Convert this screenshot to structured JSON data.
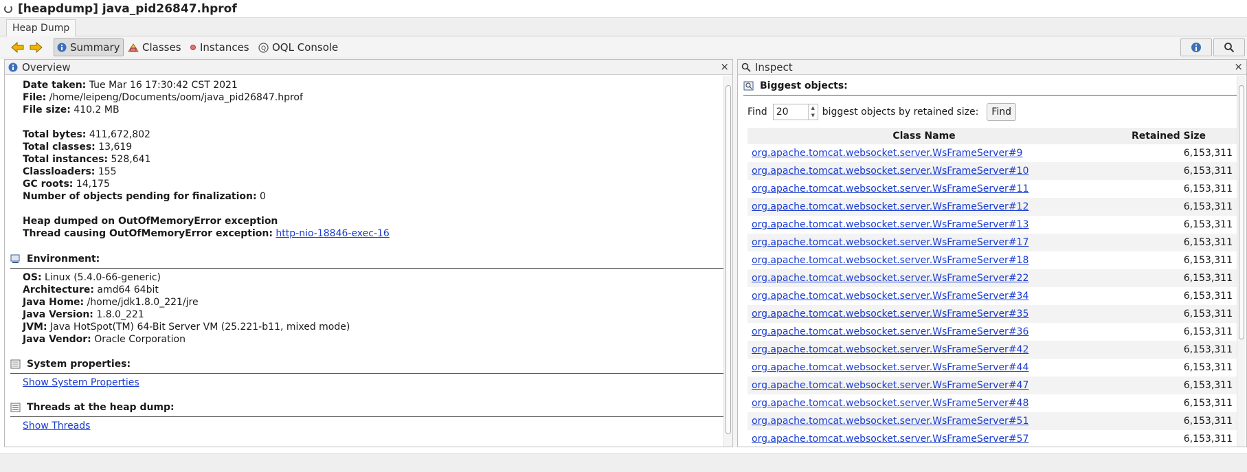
{
  "window": {
    "title": "[heapdump] java_pid26847.hprof"
  },
  "tabs": {
    "heap_dump": "Heap Dump"
  },
  "toolbar": {
    "summary": "Summary",
    "classes": "Classes",
    "instances": "Instances",
    "oql": "OQL Console"
  },
  "overview": {
    "title": "Overview",
    "close": "×",
    "basic": [
      {
        "label": "Date taken:",
        "value": "Tue Mar 16 17:30:42 CST 2021"
      },
      {
        "label": "File:",
        "value": "/home/leipeng/Documents/oom/java_pid26847.hprof"
      },
      {
        "label": "File size:",
        "value": "410.2 MB"
      }
    ],
    "totals": [
      {
        "label": "Total bytes:",
        "value": "411,672,802"
      },
      {
        "label": "Total classes:",
        "value": "13,619"
      },
      {
        "label": "Total instances:",
        "value": "528,641"
      },
      {
        "label": "Classloaders:",
        "value": "155"
      },
      {
        "label": "GC roots:",
        "value": "14,175"
      },
      {
        "label": "Number of objects pending for finalization:",
        "value": "0"
      }
    ],
    "oom_line": "Heap dumped on OutOfMemoryError exception",
    "oom_thread_label": "Thread causing OutOfMemoryError exception:",
    "oom_thread_link": "http-nio-18846-exec-16",
    "environment": {
      "heading": "Environment:",
      "items": [
        {
          "label": "OS:",
          "value": "Linux (5.4.0-66-generic)"
        },
        {
          "label": "Architecture:",
          "value": "amd64 64bit"
        },
        {
          "label": "Java Home:",
          "value": "/home/jdk1.8.0_221/jre"
        },
        {
          "label": "Java Version:",
          "value": "1.8.0_221"
        },
        {
          "label": "JVM:",
          "value": "Java HotSpot(TM) 64-Bit Server VM (25.221-b11, mixed mode)"
        },
        {
          "label": "Java Vendor:",
          "value": "Oracle Corporation"
        }
      ]
    },
    "system_properties": {
      "heading": "System properties:",
      "link": "Show System Properties"
    },
    "threads": {
      "heading": "Threads at the heap dump:",
      "link": "Show Threads"
    }
  },
  "inspect": {
    "title": "Inspect",
    "close": "×",
    "heading": "Biggest objects:",
    "find_label": "Find",
    "find_value": "20",
    "find_suffix": "biggest objects by retained size:",
    "find_button": "Find",
    "columns": {
      "name": "Class Name",
      "size": "Retained Size"
    },
    "rows": [
      {
        "name": "org.apache.tomcat.websocket.server.WsFrameServer#9",
        "size": "6,153,311"
      },
      {
        "name": "org.apache.tomcat.websocket.server.WsFrameServer#10",
        "size": "6,153,311"
      },
      {
        "name": "org.apache.tomcat.websocket.server.WsFrameServer#11",
        "size": "6,153,311"
      },
      {
        "name": "org.apache.tomcat.websocket.server.WsFrameServer#12",
        "size": "6,153,311"
      },
      {
        "name": "org.apache.tomcat.websocket.server.WsFrameServer#13",
        "size": "6,153,311"
      },
      {
        "name": "org.apache.tomcat.websocket.server.WsFrameServer#17",
        "size": "6,153,311"
      },
      {
        "name": "org.apache.tomcat.websocket.server.WsFrameServer#18",
        "size": "6,153,311"
      },
      {
        "name": "org.apache.tomcat.websocket.server.WsFrameServer#22",
        "size": "6,153,311"
      },
      {
        "name": "org.apache.tomcat.websocket.server.WsFrameServer#34",
        "size": "6,153,311"
      },
      {
        "name": "org.apache.tomcat.websocket.server.WsFrameServer#35",
        "size": "6,153,311"
      },
      {
        "name": "org.apache.tomcat.websocket.server.WsFrameServer#36",
        "size": "6,153,311"
      },
      {
        "name": "org.apache.tomcat.websocket.server.WsFrameServer#42",
        "size": "6,153,311"
      },
      {
        "name": "org.apache.tomcat.websocket.server.WsFrameServer#44",
        "size": "6,153,311"
      },
      {
        "name": "org.apache.tomcat.websocket.server.WsFrameServer#47",
        "size": "6,153,311"
      },
      {
        "name": "org.apache.tomcat.websocket.server.WsFrameServer#48",
        "size": "6,153,311"
      },
      {
        "name": "org.apache.tomcat.websocket.server.WsFrameServer#51",
        "size": "6,153,311"
      },
      {
        "name": "org.apache.tomcat.websocket.server.WsFrameServer#57",
        "size": "6,153,311"
      }
    ]
  }
}
